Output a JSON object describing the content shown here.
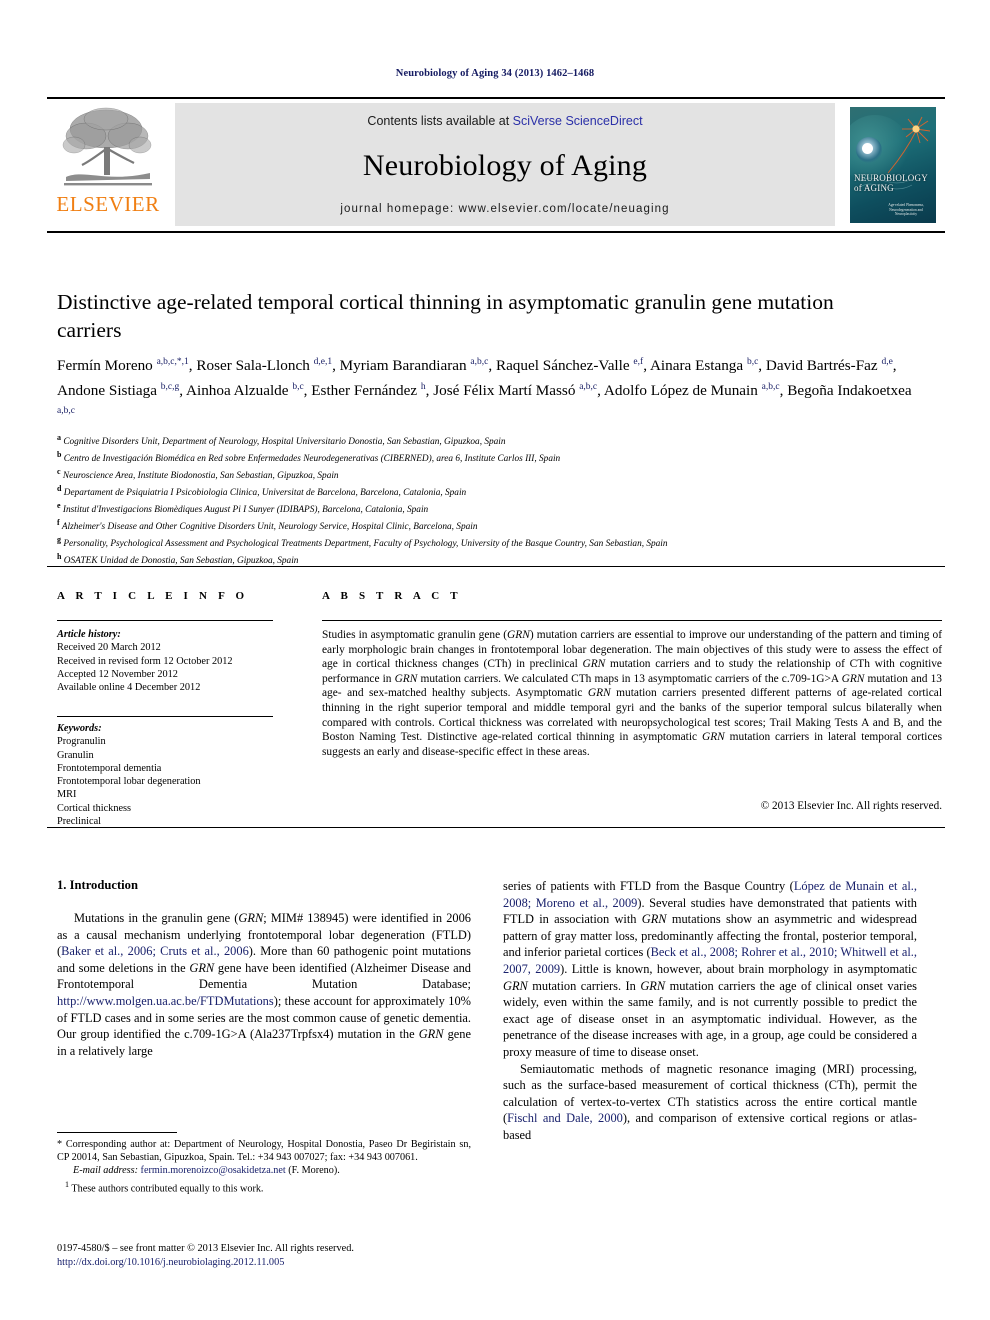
{
  "running_head": "Neurobiology of Aging 34 (2013) 1462–1468",
  "masthead": {
    "publisher": "ELSEVIER",
    "contents_prefix": "Contents lists available at ",
    "contents_link": "SciVerse ScienceDirect",
    "journal_name": "Neurobiology of Aging",
    "homepage": "journal homepage: www.elsevier.com/locate/neuaging",
    "cover_title_line1": "NEUROBIOLOGY",
    "cover_title_line2": "of AGING",
    "cover_subtitle": "Age-related Phenomena, Neurodegeneration and Neuroplasticity"
  },
  "article": {
    "title": "Distinctive age-related temporal cortical thinning in asymptomatic granulin gene mutation carriers",
    "authors": [
      {
        "name": "Fermín Moreno",
        "sup": "a,b,c,*,1",
        "sep": ", "
      },
      {
        "name": "Roser Sala-Llonch",
        "sup": "d,e,1",
        "sep": ", "
      },
      {
        "name": "Myriam Barandiaran",
        "sup": "a,b,c",
        "sep": ", "
      },
      {
        "name": "Raquel Sánchez-Valle",
        "sup": "e,f",
        "sep": ", "
      },
      {
        "name": "Ainara Estanga",
        "sup": "b,c",
        "sep": ", "
      },
      {
        "name": "David Bartrés-Faz",
        "sup": "d,e",
        "sep": ", "
      },
      {
        "name": "Andone Sistiaga",
        "sup": "b,c,g",
        "sep": ", "
      },
      {
        "name": "Ainhoa Alzualde",
        "sup": "b,c",
        "sep": ", "
      },
      {
        "name": "Esther Fernández",
        "sup": "h",
        "sep": ", "
      },
      {
        "name": "José Félix Martí Massó",
        "sup": "a,b,c",
        "sep": ", "
      },
      {
        "name": "Adolfo López de Munain",
        "sup": "a,b,c",
        "sep": ", "
      },
      {
        "name": "Begoña Indakoetxea",
        "sup": "a,b,c",
        "sep": ""
      }
    ],
    "affiliations": [
      {
        "mark": "a",
        "text": "Cognitive Disorders Unit, Department of Neurology, Hospital Universitario Donostia, San Sebastian, Gipuzkoa, Spain"
      },
      {
        "mark": "b",
        "text": "Centro de Investigación Biomédica en Red sobre Enfermedades Neurodegenerativas (CIBERNED), area 6, Institute Carlos III, Spain"
      },
      {
        "mark": "c",
        "text": "Neuroscience Area, Institute Biodonostia, San Sebastian, Gipuzkoa, Spain"
      },
      {
        "mark": "d",
        "text": "Departament de Psiquiatria I Psicobiologia Clinica, Universitat de Barcelona, Barcelona, Catalonia, Spain"
      },
      {
        "mark": "e",
        "text": "Institut d'Investigacions Biomèdiques August Pi I Sunyer (IDIBAPS), Barcelona, Catalonia, Spain"
      },
      {
        "mark": "f",
        "text": "Alzheimer's Disease and Other Cognitive Disorders Unit, Neurology Service, Hospital Clinic, Barcelona, Spain"
      },
      {
        "mark": "g",
        "text": "Personality, Psychological Assessment and Psychological Treatments Department, Faculty of Psychology, University of the Basque Country, San Sebastian, Spain"
      },
      {
        "mark": "h",
        "text": "OSATEK Unidad de Donostia, San Sebastian, Gipuzkoa, Spain"
      }
    ]
  },
  "article_info": {
    "heading": "A R T I C L E   I N F O",
    "history_label": "Article history:",
    "history": [
      "Received 20 March 2012",
      "Received in revised form 12 October 2012",
      "Accepted 12 November 2012",
      "Available online 4 December 2012"
    ],
    "keywords_label": "Keywords:",
    "keywords": [
      "Progranulin",
      "Granulin",
      "Frontotemporal dementia",
      "Frontotemporal lobar degeneration",
      "MRI",
      "Cortical thickness",
      "Preclinical"
    ]
  },
  "abstract": {
    "heading": "A B S T R A C T",
    "body": "Studies in asymptomatic granulin gene (GRN) mutation carriers are essential to improve our understanding of the pattern and timing of early morphologic brain changes in frontotemporal lobar degeneration. The main objectives of this study were to assess the effect of age in cortical thickness changes (CTh) in preclinical GRN mutation carriers and to study the relationship of CTh with cognitive performance in GRN mutation carriers. We calculated CTh maps in 13 asymptomatic carriers of the c.709-1G>A GRN mutation and 13 age- and sex-matched healthy subjects. Asymptomatic GRN mutation carriers presented different patterns of age-related cortical thinning in the right superior temporal and middle temporal gyri and the banks of the superior temporal sulcus bilaterally when compared with controls. Cortical thickness was correlated with neuropsychological test scores; Trail Making Tests A and B, and the Boston Naming Test. Distinctive age-related cortical thinning in asymptomatic GRN mutation carriers in lateral temporal cortices suggests an early and disease-specific effect in these areas.",
    "copyright": "© 2013 Elsevier Inc. All rights reserved."
  },
  "body": {
    "section_heading": "1. Introduction",
    "left_paragraph_1": "Mutations in the granulin gene (GRN; MIM# 138945) were identified in 2006 as a causal mechanism underlying frontotemporal lobar degeneration (FTLD) (Baker et al., 2006; Cruts et al., 2006). More than 60 pathogenic point mutations and some deletions in the GRN gene have been identified (Alzheimer Disease and Frontotemporal Dementia Mutation Database; http://www.molgen.ua.ac.be/FTDMutations); these account for approximately 10% of FTLD cases and in some series are the most common cause of genetic dementia. Our group identified the c.709-1G>A (Ala237Trpfsx4) mutation in the GRN gene in a relatively large",
    "right_paragraph_1": "series of patients with FTLD from the Basque Country (López de Munain et al., 2008; Moreno et al., 2009). Several studies have demonstrated that patients with FTLD in association with GRN mutations show an asymmetric and widespread pattern of gray matter loss, predominantly affecting the frontal, posterior temporal, and inferior parietal cortices (Beck et al., 2008; Rohrer et al., 2010; Whitwell et al., 2007, 2009). Little is known, however, about brain morphology in asymptomatic GRN mutation carriers. In GRN mutation carriers the age of clinical onset varies widely, even within the same family, and is not currently possible to predict the exact age of disease onset in an asymptomatic individual. However, as the penetrance of the disease increases with age, in a group, age could be considered a proxy measure of time to disease onset.",
    "right_paragraph_2": "Semiautomatic methods of magnetic resonance imaging (MRI) processing, such as the surface-based measurement of cortical thickness (CTh), permit the calculation of vertex-to-vertex CTh statistics across the entire cortical mantle (Fischl and Dale, 2000), and comparison of extensive cortical regions or atlas-based"
  },
  "footnotes": {
    "corresponding": "* Corresponding author at: Department of Neurology, Hospital Donostia, Paseo Dr Begiristain sn, CP 20014, San Sebastian, Gipuzkoa, Spain. Tel.: +34 943 007027; fax: +34 943 007061.",
    "email_label": "E-mail address:",
    "email": "fermin.morenoizco@osakidetza.net",
    "email_suffix": "(F. Moreno).",
    "equal_contrib_mark": "1",
    "equal_contrib": "These authors contributed equally to this work.",
    "issn_line": "0197-4580/$ – see front matter © 2013 Elsevier Inc. All rights reserved.",
    "doi": "http://dx.doi.org/10.1016/j.neurobiolaging.2012.11.005"
  }
}
